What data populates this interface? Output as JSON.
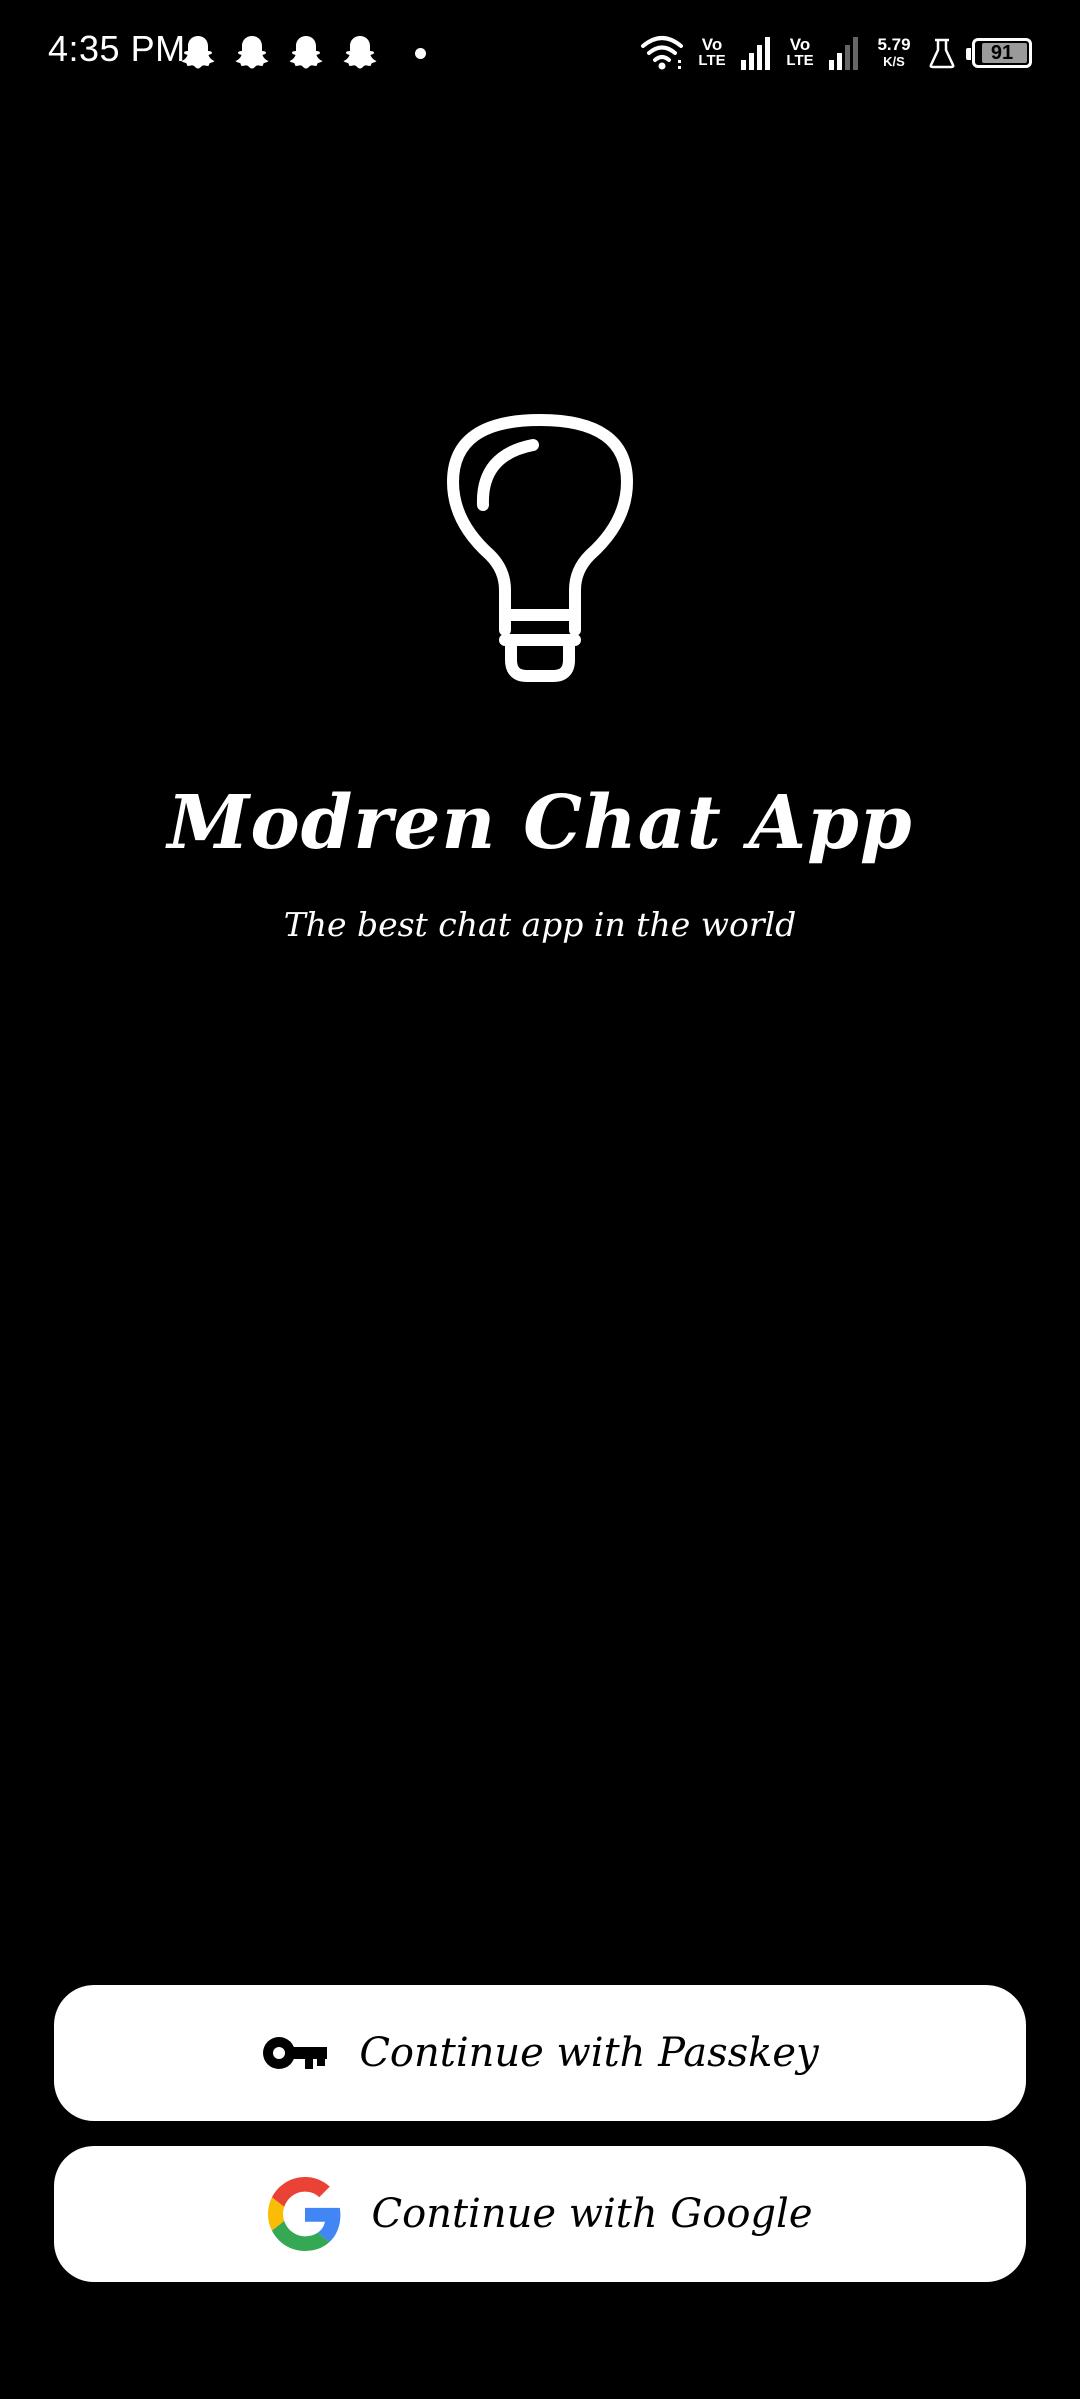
{
  "status_bar": {
    "time": "4:35 PM",
    "notifications": [
      "snapchat-icon",
      "snapchat-icon",
      "snapchat-icon",
      "snapchat-icon"
    ],
    "sim1": {
      "top": "Vo",
      "bottom": "LTE"
    },
    "sim2": {
      "top": "Vo",
      "bottom": "LTE"
    },
    "net_speed_value": "5.79",
    "net_speed_unit": "K/S",
    "battery": "91",
    "battery_level": 0.91
  },
  "hero": {
    "icon": "lightbulb-icon",
    "title": "Modren Chat App",
    "subtitle": "The best chat app in the world"
  },
  "actions": {
    "passkey_label": "Continue with Passkey",
    "google_label": "Continue with Google"
  },
  "colors": {
    "background": "#000000",
    "foreground": "#ffffff",
    "button_bg": "#ffffff",
    "button_text": "#000000",
    "google_blue": "#4285F4",
    "google_red": "#EA4335",
    "google_yellow": "#FBBC05",
    "google_green": "#34A853"
  }
}
